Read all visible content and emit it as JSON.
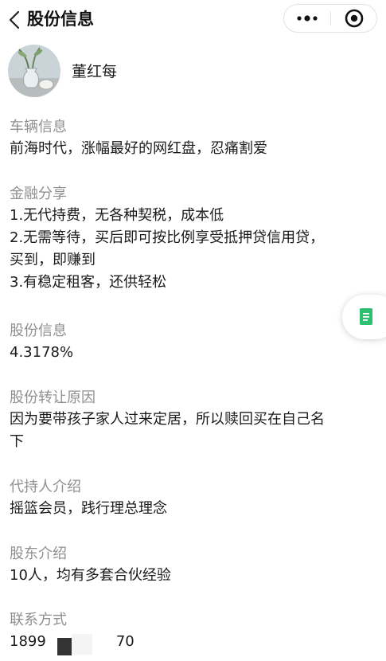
{
  "header": {
    "title": "股份信息"
  },
  "author": {
    "name": "董红每"
  },
  "sections": [
    {
      "label": "车辆信息",
      "lines": [
        "前海时代，涨幅最好的网红盘，忍痛割爱"
      ]
    },
    {
      "label": "金融分享",
      "lines": [
        "1.无代持费，无各种契税，成本低",
        "2.无需等待，买后即可按比例享受抵押贷信用贷，",
        "买到，即赚到",
        "3.有稳定租客，还供轻松"
      ]
    },
    {
      "label": "股份信息",
      "lines": [
        "4.3178%"
      ]
    },
    {
      "label": "股份转让原因",
      "lines": [
        "因为要带孩子家人过来定居，所以赎回买在自己名",
        "下"
      ]
    },
    {
      "label": "代持人介绍",
      "lines": [
        "摇篮会员，践行理总理念"
      ]
    },
    {
      "label": "股东介绍",
      "lines": [
        "10人，均有多套合伙经验"
      ]
    },
    {
      "label": "联系方式",
      "lines": [
        "1899",
        "70"
      ]
    }
  ],
  "icons": {
    "back": "chevron-left-icon",
    "more": "more-dots-icon",
    "target": "target-icon",
    "float": "document-icon"
  },
  "colors": {
    "label_gray": "#8f8f8f",
    "text": "#1a1a1a",
    "float_icon_green": "#2fbf71"
  }
}
